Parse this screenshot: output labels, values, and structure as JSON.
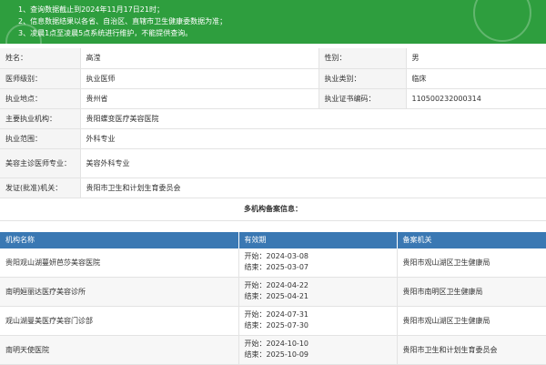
{
  "notice": {
    "lines": [
      "1、查询数据截止到2024年11月17日21时；",
      "2、信息数据结果以各省、自治区、直辖市卫生健康委数据为准；",
      "3、凌晨1点至凌晨5点系统进行维护，不能提供查询。"
    ]
  },
  "profile": {
    "name_label": "姓名：",
    "name": "高滢",
    "gender_label": "性别：",
    "gender": "男",
    "level_label": "医师级别：",
    "level": "执业医师",
    "category_label": "执业类别：",
    "category": "临床",
    "location_label": "执业地点：",
    "location": "贵州省",
    "cert_label": "执业证书编码：",
    "cert": "110500232000314",
    "institution_label": "主要执业机构：",
    "institution": "贵阳蝶变医疗美容医院",
    "scope_label": "执业范围：",
    "scope": "外科专业",
    "beauty_label": "美容主诊医师专业：",
    "beauty": "美容外科专业",
    "issuer_label": "发证(批准)机关：",
    "issuer": "贵阳市卫生和计划生育委员会"
  },
  "filing": {
    "title": "多机构备案信息：",
    "columns": [
      "机构名称",
      "有效期",
      "备案机关"
    ],
    "start_prefix": "开始：",
    "end_prefix": "结束：",
    "rows": [
      {
        "name": "贵阳观山湖蔓妍芭莎美容医院",
        "start": "2024-03-08",
        "end": "2025-03-07",
        "authority": "贵阳市观山湖区卫生健康局"
      },
      {
        "name": "南明姮丽达医疗美容诊所",
        "start": "2024-04-22",
        "end": "2025-04-21",
        "authority": "贵阳市南明区卫生健康局"
      },
      {
        "name": "观山湖曼美医疗美容门诊部",
        "start": "2024-07-31",
        "end": "2025-07-30",
        "authority": "贵阳市观山湖区卫生健康局"
      },
      {
        "name": "南明天使医院",
        "start": "2024-10-10",
        "end": "2025-10-09",
        "authority": "贵阳市卫生和计划生育委员会"
      }
    ]
  }
}
